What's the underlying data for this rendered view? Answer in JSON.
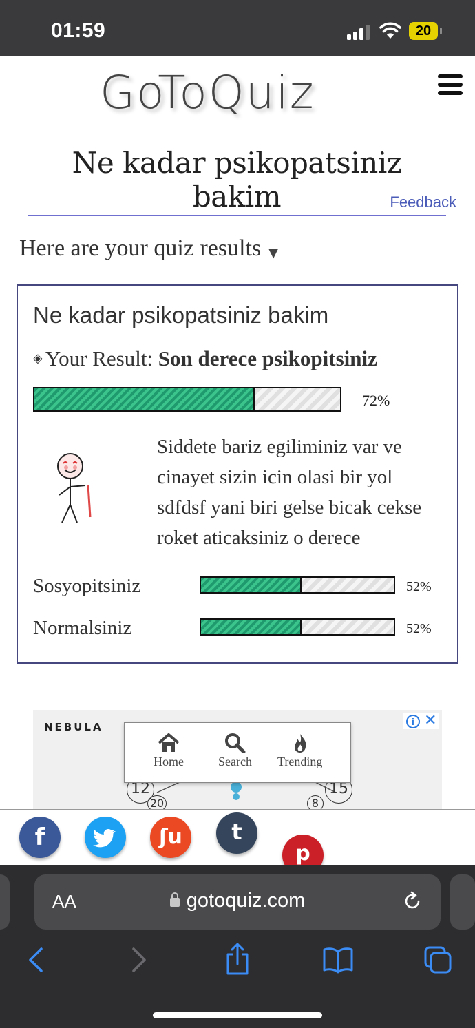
{
  "status_bar": {
    "time": "01:59",
    "battery": "20"
  },
  "header": {
    "logo": "GoToQuiz",
    "menu_icon": "hamburger-icon"
  },
  "quiz": {
    "title": "Ne kadar psikopatsiniz bakim",
    "feedback_label": "Feedback"
  },
  "results": {
    "heading": "Here are your quiz results",
    "card_title": "Ne kadar psikopatsiniz bakim",
    "your_result_label": "Your Result:",
    "result_name": "Son derece psikopitsiniz",
    "result_percent": 72,
    "result_percent_label": "72%",
    "description": "Siddete bariz egiliminiz var ve cinayet sizin icin olasi bir yol sdfdsf yani biri gelse bicak cekse roket aticaksiniz o derece",
    "others": [
      {
        "label": "Sosyopitsiniz",
        "percent": 52,
        "percent_label": "52%"
      },
      {
        "label": "Normalsiniz",
        "percent": 52,
        "percent_label": "52%"
      }
    ]
  },
  "ad": {
    "brand": "NEBULA",
    "badge_close": "✕",
    "badge_info": "i",
    "numbers": [
      "12",
      "20",
      "15",
      "8"
    ]
  },
  "nav_popup": {
    "items": [
      {
        "label": "Home",
        "icon": "home-icon"
      },
      {
        "label": "Search",
        "icon": "search-icon"
      },
      {
        "label": "Trending",
        "icon": "flame-icon"
      }
    ]
  },
  "share": {
    "buttons": [
      "facebook",
      "twitter",
      "stumbleupon",
      "tumblr",
      "pinterest"
    ],
    "colors": {
      "facebook": "#3b5998",
      "twitter": "#1da1f2",
      "stumbleupon": "#eb4924",
      "tumblr": "#35465c",
      "pinterest": "#cb2027"
    }
  },
  "browser": {
    "aa_label": "AA",
    "url": "gotoquiz.com"
  }
}
